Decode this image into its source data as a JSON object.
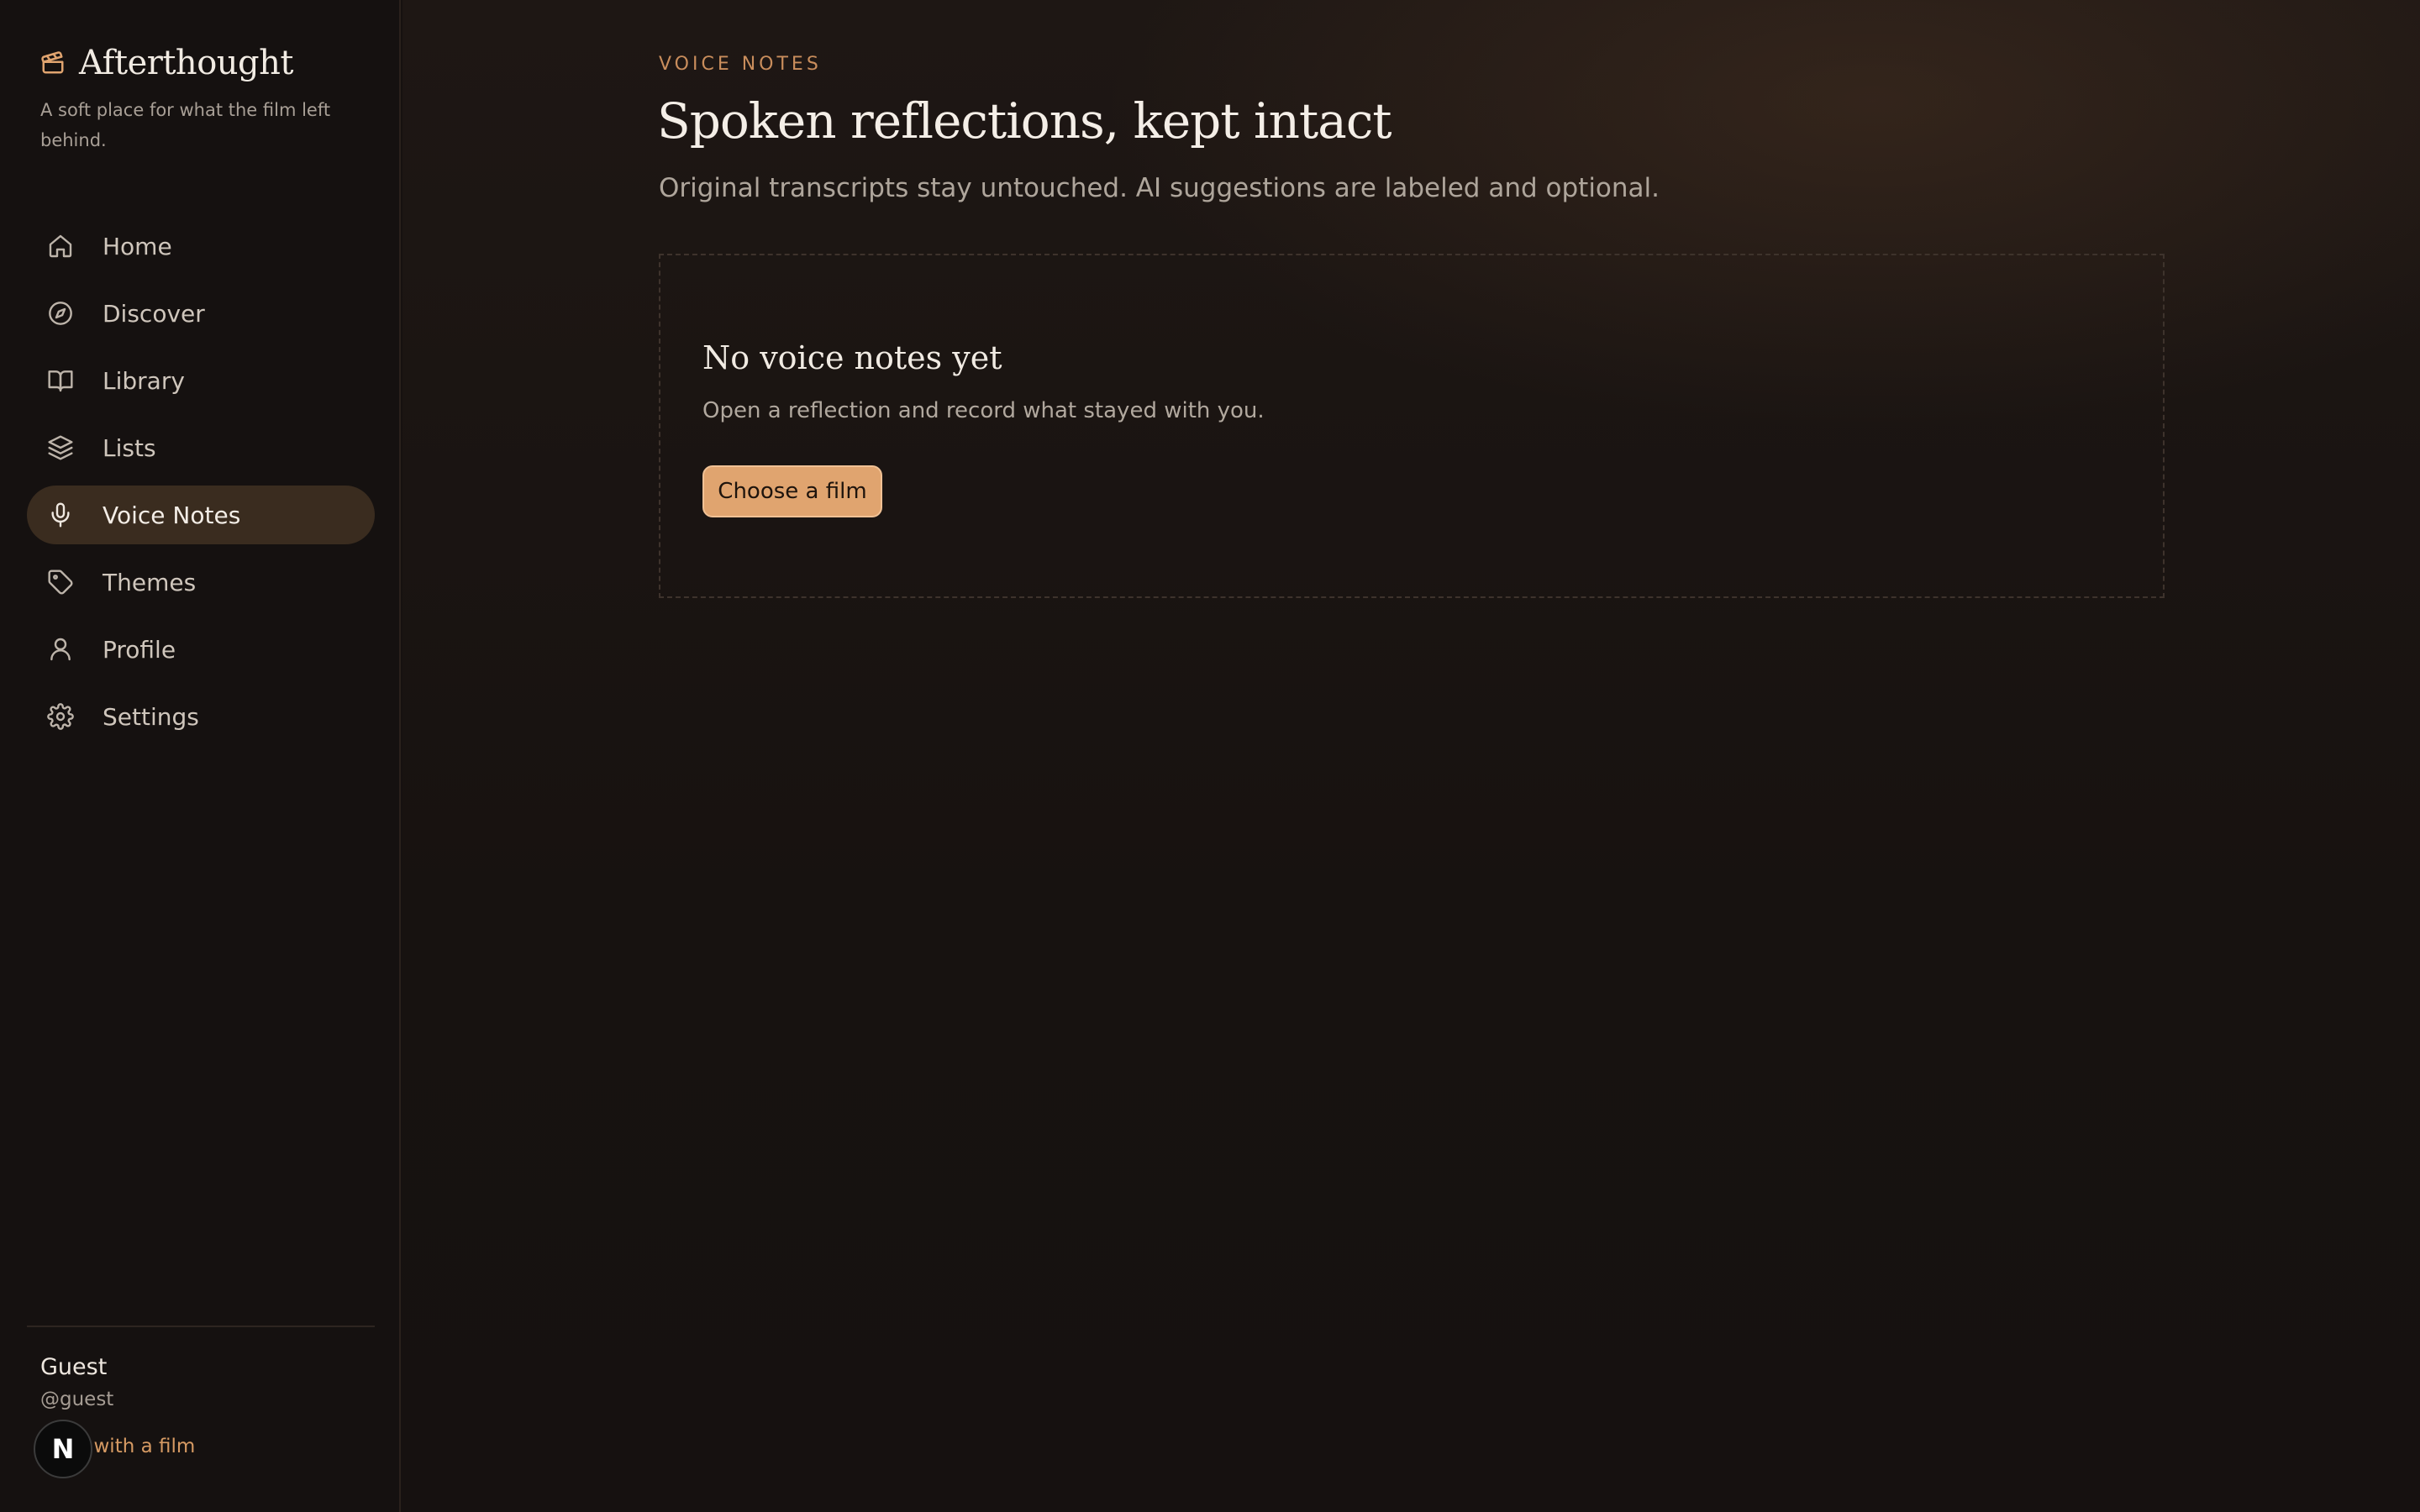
{
  "brand": {
    "name": "Afterthought",
    "icon": "clapperboard-icon",
    "tagline": "A soft place for what the film left behind."
  },
  "nav": {
    "items": [
      {
        "label": "Home",
        "icon": "home-icon",
        "active": false
      },
      {
        "label": "Discover",
        "icon": "compass-icon",
        "active": false
      },
      {
        "label": "Library",
        "icon": "book-open-icon",
        "active": false
      },
      {
        "label": "Lists",
        "icon": "layers-icon",
        "active": false
      },
      {
        "label": "Voice Notes",
        "icon": "microphone-icon",
        "active": true
      },
      {
        "label": "Themes",
        "icon": "tag-icon",
        "active": false
      },
      {
        "label": "Profile",
        "icon": "user-icon",
        "active": false
      },
      {
        "label": "Settings",
        "icon": "gear-icon",
        "active": false
      }
    ]
  },
  "user": {
    "name": "Guest",
    "handle": "@guest",
    "link_text": "Start with a film",
    "badge_letter": "N"
  },
  "main": {
    "eyebrow": "VOICE NOTES",
    "title": "Spoken reflections, kept intact",
    "subtitle": "Original transcripts stay untouched. AI suggestions are labeled and optional.",
    "empty_state": {
      "title": "No voice notes yet",
      "description": "Open a reflection and record what stayed with you.",
      "button_label": "Choose a film"
    }
  },
  "colors": {
    "accent": "#e0a46f",
    "accent_text": "#d69a63",
    "background": "#161110",
    "active_nav": "#3a2c1f"
  }
}
